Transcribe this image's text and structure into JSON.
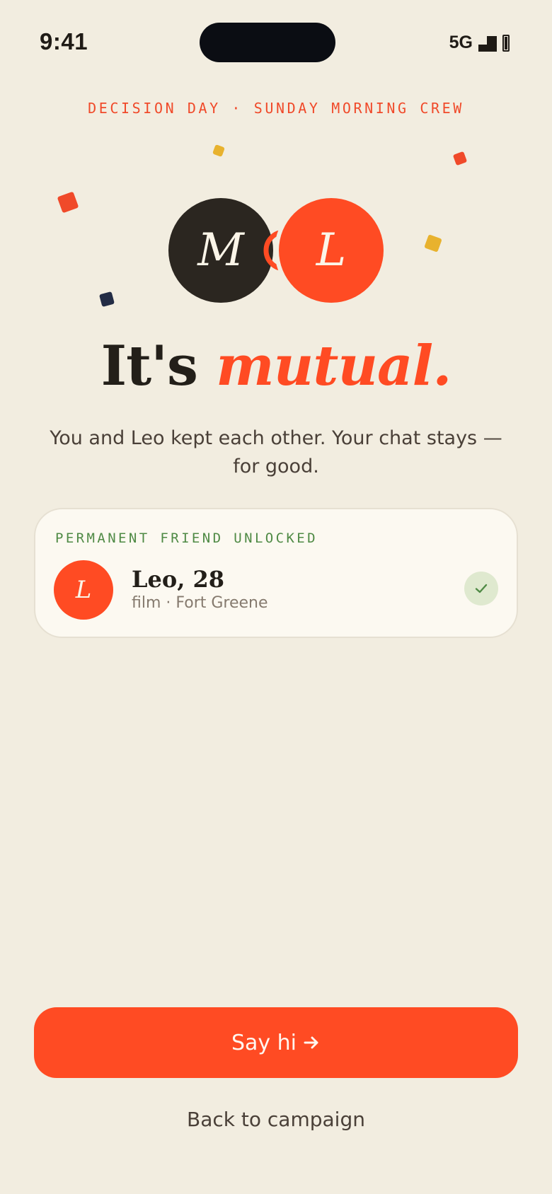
{
  "status_bar": {
    "time": "9:41",
    "network": "5G",
    "signal_icon": "signal-icon",
    "battery_icon": "battery-icon"
  },
  "eyebrow": "DECISION DAY · SUNDAY MORNING CREW",
  "avatars": {
    "left_initial": "M",
    "right_initial": "L"
  },
  "headline": {
    "lead": "It's",
    "accent": "mutual."
  },
  "subtext": "You and Leo kept each other. Your chat stays — for good.",
  "friend_card": {
    "label": "PERMANENT FRIEND UNLOCKED",
    "initial": "L",
    "name": "Leo, 28",
    "meta": "film · Fort Greene",
    "status_icon": "check-icon"
  },
  "actions": {
    "primary_label": "Say hi",
    "primary_icon": "arrow-right-icon",
    "secondary_label": "Back to campaign"
  },
  "colors": {
    "background": "#f2ede0",
    "accent": "#ff4b23",
    "dark": "#2b2620",
    "success": "#4f8a45",
    "confetti_yellow": "#e8b22e",
    "confetti_navy": "#232c45"
  }
}
